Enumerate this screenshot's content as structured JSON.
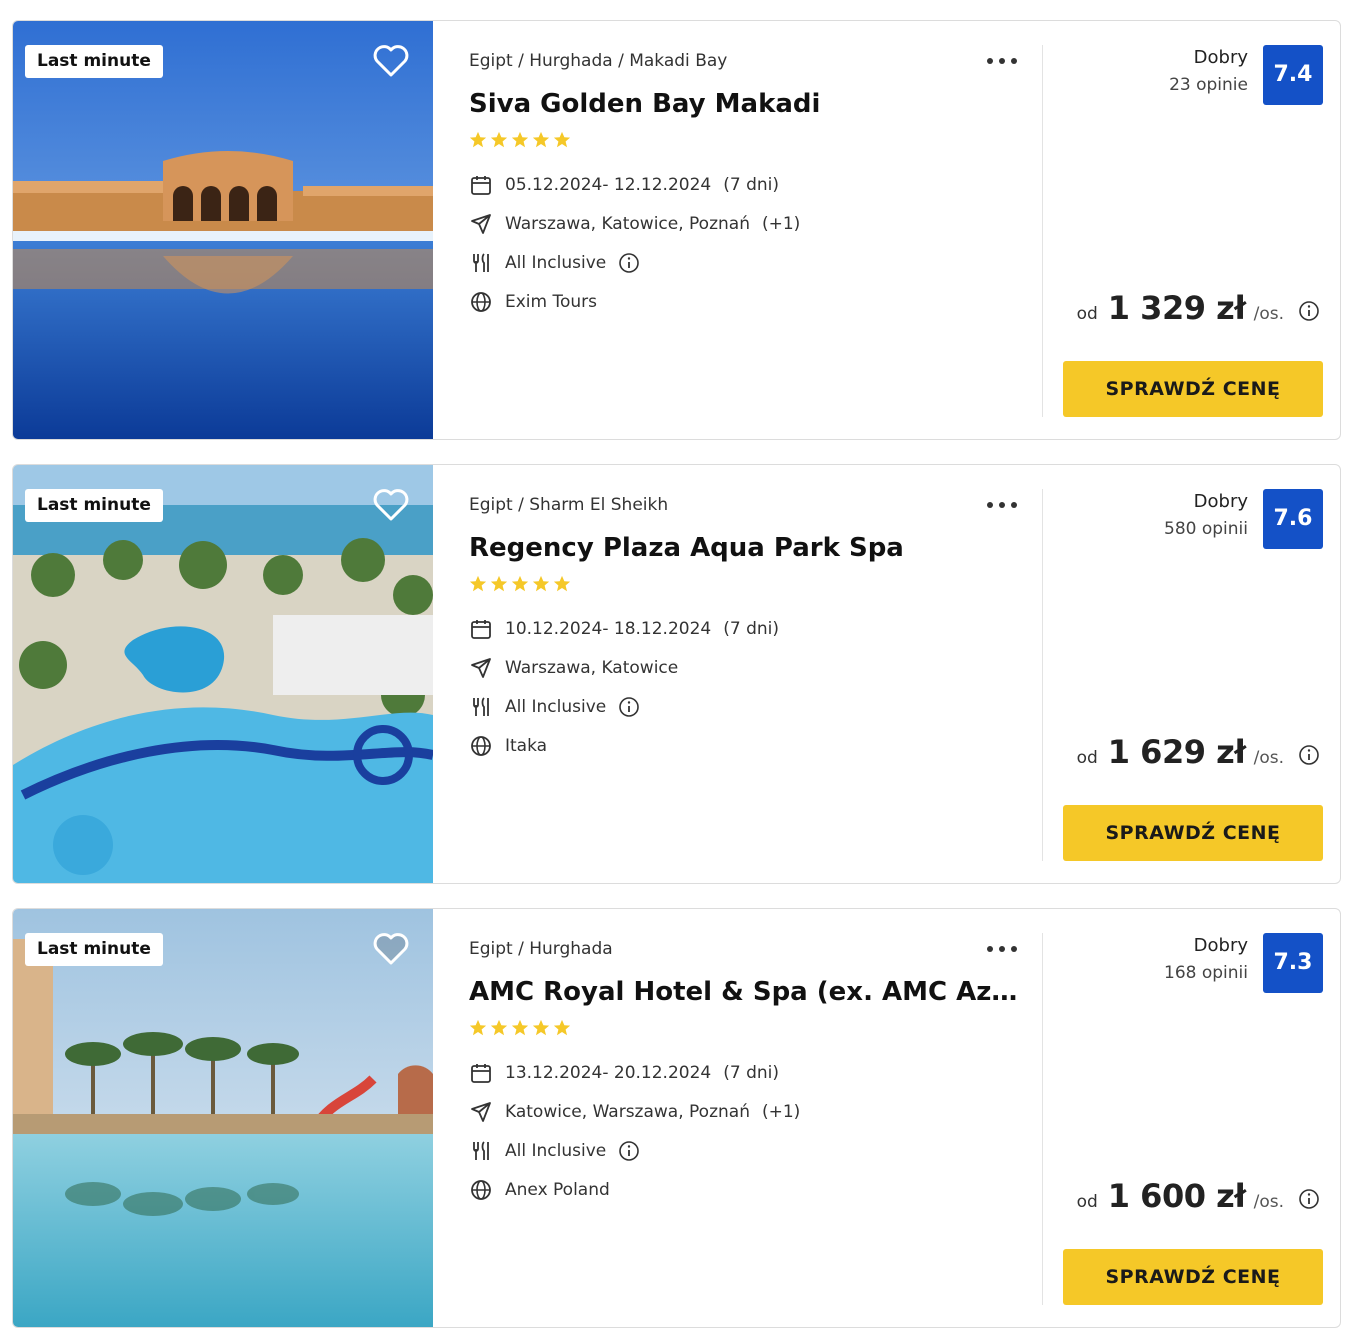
{
  "offers": [
    {
      "badge": "Last minute",
      "breadcrumb": "Egipt / Hurghada / Makadi Bay",
      "name": "Siva Golden Bay Makadi",
      "stars": 5,
      "dates": "05.12.2024- 12.12.2024",
      "duration": "(7 dni)",
      "departures": "Warszawa, Katowice, Poznań",
      "departures_extra": "(+1)",
      "board": "All Inclusive",
      "operator": "Exim Tours",
      "rating_label": "Dobry",
      "reviews": "23 opinie",
      "score": "7.4",
      "price_prefix": "od",
      "price": "1 329 zł",
      "price_suffix": "/os.",
      "cta": "SPRAWDŹ CENĘ"
    },
    {
      "badge": "Last minute",
      "breadcrumb": "Egipt / Sharm El Sheikh",
      "name": "Regency Plaza Aqua Park Spa",
      "stars": 5,
      "dates": "10.12.2024- 18.12.2024",
      "duration": "(7 dni)",
      "departures": "Warszawa, Katowice",
      "departures_extra": "",
      "board": "All Inclusive",
      "operator": "Itaka",
      "rating_label": "Dobry",
      "reviews": "580 opinii",
      "score": "7.6",
      "price_prefix": "od",
      "price": "1 629 zł",
      "price_suffix": "/os.",
      "cta": "SPRAWDŹ CENĘ"
    },
    {
      "badge": "Last minute",
      "breadcrumb": "Egipt / Hurghada",
      "name": "AMC Royal Hotel & Spa (ex. AMC Azur Resort)",
      "stars": 5,
      "dates": "13.12.2024- 20.12.2024",
      "duration": "(7 dni)",
      "departures": "Katowice, Warszawa, Poznań",
      "departures_extra": "(+1)",
      "board": "All Inclusive",
      "operator": "Anex Poland",
      "rating_label": "Dobry",
      "reviews": "168 opinii",
      "score": "7.3",
      "price_prefix": "od",
      "price": "1 600 zł",
      "price_suffix": "/os.",
      "cta": "SPRAWDŹ CENĘ"
    }
  ],
  "colors": {
    "score_bg": "#1451c7",
    "cta_bg": "#f5c828",
    "star": "#f5c828"
  },
  "icons": {
    "favorite": "heart-icon",
    "more": "more-dots-icon",
    "date": "calendar-icon",
    "departure": "plane-icon",
    "board": "cutlery-icon",
    "operator": "globe-icon",
    "info": "info-icon"
  }
}
